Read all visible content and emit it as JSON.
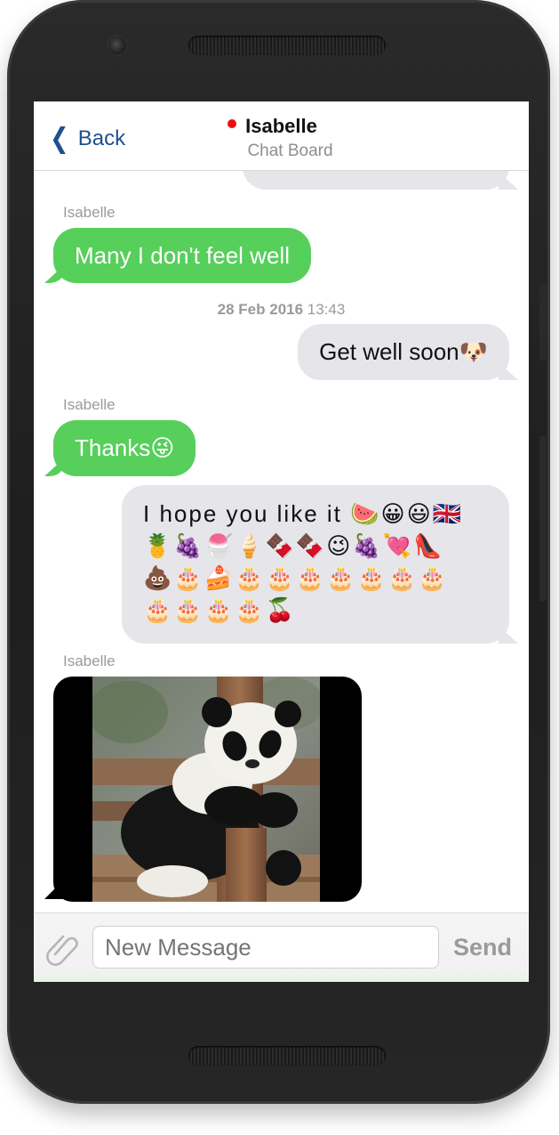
{
  "header": {
    "back_label": "Back",
    "title": "Isabelle",
    "subtitle": "Chat Board",
    "status_color": "#f00d0d"
  },
  "messages": [
    {
      "type": "in",
      "sender": "Isabelle",
      "text": "Many I don't feel well"
    },
    {
      "type": "timestamp",
      "date": "28 Feb 2016",
      "time": "13:43"
    },
    {
      "type": "out",
      "text": "Get well soon",
      "emoji": "🐶"
    },
    {
      "type": "in",
      "sender": "Isabelle",
      "text": "Thanks",
      "emoji": "😜"
    },
    {
      "type": "out",
      "text": "I hope you like it",
      "emoji_line1": "🍉😀😃🇬🇧",
      "emoji_line2": "🍍🍇🍧🍦🍫🍫😉🍇💘👠",
      "emoji_line3": "💩🎂🍰🎂🎂🎂🎂🎂🎂🎂",
      "emoji_line4": "🎂🎂🎂🎂🍒"
    },
    {
      "type": "in-image",
      "sender": "Isabelle",
      "image": "panda"
    }
  ],
  "composer": {
    "placeholder": "New Message",
    "send_label": "Send",
    "attach_icon": "paperclip-icon"
  },
  "colors": {
    "incoming": "#56cf5b",
    "outgoing": "#e5e5ea",
    "accent": "#1f4f8f"
  }
}
